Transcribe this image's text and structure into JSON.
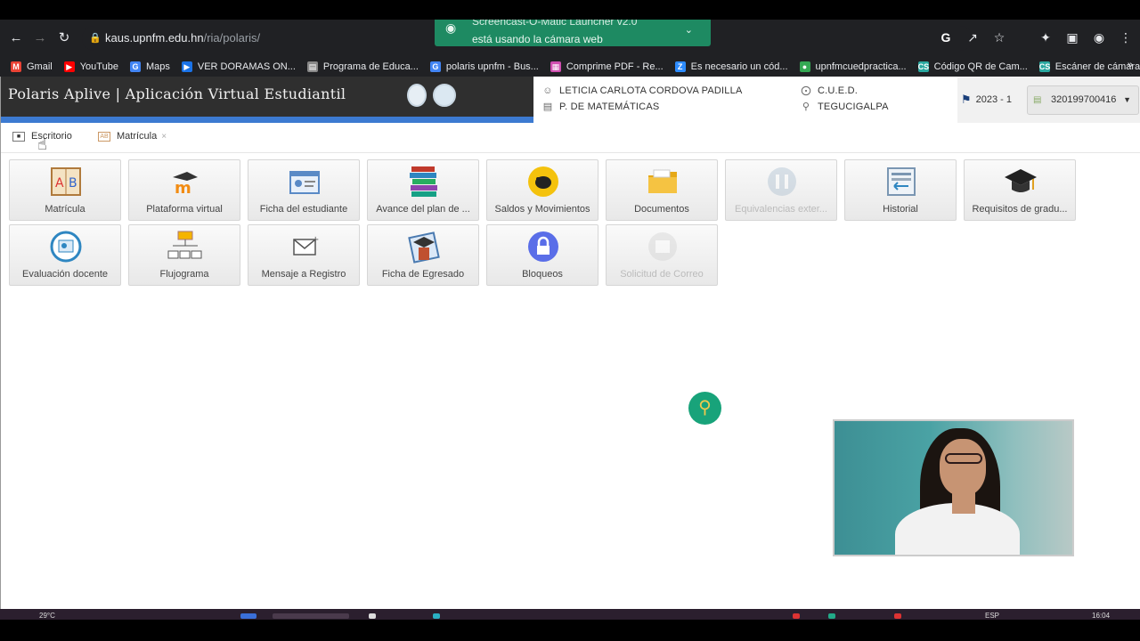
{
  "browser": {
    "url_host": "kaus.upnfm.edu.hn",
    "url_path": "/ria/polaris/"
  },
  "notification": {
    "line1": "Screencast-O-Matic Launcher v2.0",
    "line2": "está usando la cámara web"
  },
  "bookmarks": [
    {
      "label": "Gmail",
      "icon": "gmail-icon",
      "color": "#ea4335"
    },
    {
      "label": "YouTube",
      "icon": "youtube-icon",
      "color": "#ff0000"
    },
    {
      "label": "Maps",
      "icon": "google-icon",
      "color": "#4285f4"
    },
    {
      "label": "VER DORAMAS ON...",
      "icon": "play-icon",
      "color": "#1a73e8"
    },
    {
      "label": "Programa de Educa...",
      "icon": "doc-icon",
      "color": "#888888"
    },
    {
      "label": "polaris upnfm - Bus...",
      "icon": "google-icon",
      "color": "#4285f4"
    },
    {
      "label": "Comprime PDF - Re...",
      "icon": "pdf-icon",
      "color": "#d04fb0"
    },
    {
      "label": "Es necesario un cód...",
      "icon": "zoom-icon",
      "color": "#2d8cff"
    },
    {
      "label": "upnfmcuedpractica...",
      "icon": "globe-icon",
      "color": "#34a853"
    },
    {
      "label": "Código QR de Cam...",
      "icon": "cs-icon",
      "color": "#2aa8a0"
    },
    {
      "label": "Escáner de cámara",
      "icon": "cs-icon",
      "color": "#2aa8a0"
    }
  ],
  "app": {
    "title": "Polaris Aplive | Aplicación Virtual Estudiantil",
    "user_name": "LETICIA CARLOTA CORDOVA PADILLA",
    "program": "P. DE MATEMÁTICAS",
    "center": "C.U.E.D.",
    "city": "TEGUCIGALPA",
    "period": "2023 - 1",
    "account": "320199700416"
  },
  "tabs": [
    {
      "label": "Escritorio",
      "closable": false
    },
    {
      "label": "Matrícula",
      "closable": true
    }
  ],
  "tiles": [
    {
      "label": "Matrícula",
      "icon": "ab-book-icon",
      "enabled": true
    },
    {
      "label": "Plataforma virtual",
      "icon": "moodle-icon",
      "enabled": true
    },
    {
      "label": "Ficha del estudiante",
      "icon": "id-card-icon",
      "enabled": true
    },
    {
      "label": "Avance del plan de ...",
      "icon": "books-stack-icon",
      "enabled": true
    },
    {
      "label": "Saldos y Movimientos",
      "icon": "piggy-bank-icon",
      "enabled": true
    },
    {
      "label": "Documentos",
      "icon": "folder-icon",
      "enabled": true
    },
    {
      "label": "Equivalencias exter...",
      "icon": "equivalence-icon",
      "enabled": false
    },
    {
      "label": "Historial",
      "icon": "history-icon",
      "enabled": true
    },
    {
      "label": "Requisitos de gradu...",
      "icon": "graduation-cap-icon",
      "enabled": true
    },
    {
      "label": "Evaluación docente",
      "icon": "evaluation-icon",
      "enabled": true
    },
    {
      "label": "Flujograma",
      "icon": "flowchart-icon",
      "enabled": true
    },
    {
      "label": "Mensaje a Registro",
      "icon": "mail-icon",
      "enabled": true
    },
    {
      "label": "Ficha de Egresado",
      "icon": "graduate-card-icon",
      "enabled": true
    },
    {
      "label": "Bloqueos",
      "icon": "lock-icon",
      "enabled": true
    },
    {
      "label": "Solicitud de Correo",
      "icon": "email-request-icon",
      "enabled": false
    }
  ],
  "taskbar": {
    "weather": "29°C",
    "lang": "ESP",
    "time": "16:04"
  }
}
